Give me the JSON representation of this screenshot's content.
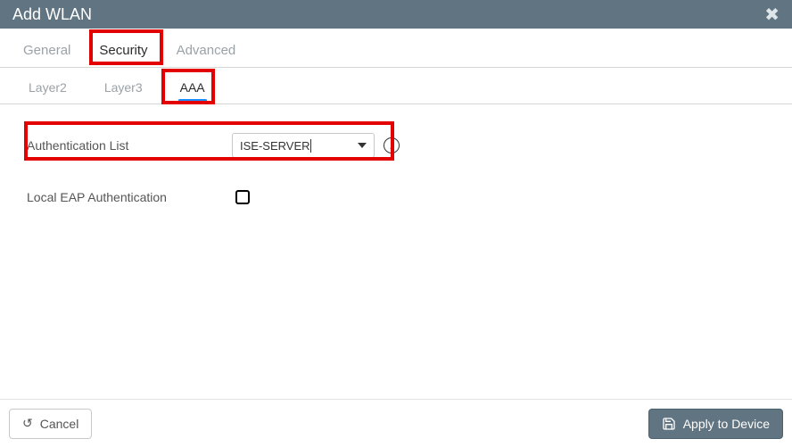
{
  "title": "Add WLAN",
  "tabs": {
    "general": "General",
    "security": "Security",
    "advanced": "Advanced"
  },
  "subtabs": {
    "layer2": "Layer2",
    "layer3": "Layer3",
    "aaa": "AAA"
  },
  "form": {
    "auth_list_label": "Authentication List",
    "auth_list_value": "ISE-SERVER",
    "local_eap_label": "Local EAP Authentication"
  },
  "footer": {
    "cancel": "Cancel",
    "apply": "Apply to Device"
  }
}
